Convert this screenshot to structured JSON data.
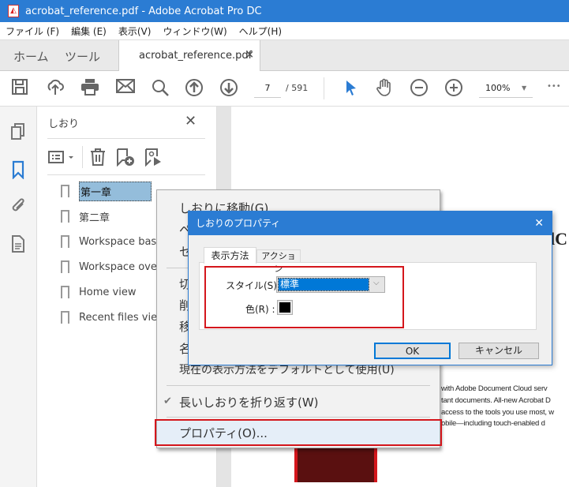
{
  "window": {
    "title": "acrobat_reference.pdf - Adobe Acrobat Pro DC"
  },
  "menubar": [
    "ファイル (F)",
    "編集 (E)",
    "表示(V)",
    "ウィンドウ(W)",
    "ヘルプ(H)"
  ],
  "tabs": {
    "home": "ホーム",
    "tools": "ツール",
    "document": "acrobat_reference.pdf",
    "close": "×"
  },
  "toolbar": {
    "page_current": "7",
    "page_total": "/ 591",
    "zoom": "100%",
    "more": "•••"
  },
  "panel": {
    "title": "しおり",
    "close": "✕",
    "bookmarks": [
      "第一章",
      "第二章",
      "Workspace basics",
      "Workspace overview",
      "Home view",
      "Recent files view"
    ]
  },
  "context_menu": {
    "items": [
      "しおりに移動(G)",
      "ペ",
      "セ",
      "切",
      "削",
      "移",
      "名",
      "現在の表示方法をデフォルトとして使用(U)",
      "長いしおりを折り返す(W)",
      "プロパティ(O)..."
    ],
    "check": "✔"
  },
  "dialog": {
    "title": "しおりのプロパティ",
    "close": "✕",
    "tabs": [
      "表示方法",
      "アクション"
    ],
    "style_label": "スタイル(S) :",
    "style_value": "標準",
    "color_label": "色(R) :",
    "color_value": "#000000",
    "ok": "OK",
    "cancel": "キャンセル"
  },
  "document": {
    "heading_fragment": "lC",
    "lines": [
      "with Adobe Document Cloud serv",
      "tant documents. All-new Acrobat D",
      "access to the tools you use most, w",
      "obile—including touch-enabled d"
    ]
  },
  "colors": {
    "accent": "#2b7cd3",
    "highlight": "#d4161c"
  }
}
